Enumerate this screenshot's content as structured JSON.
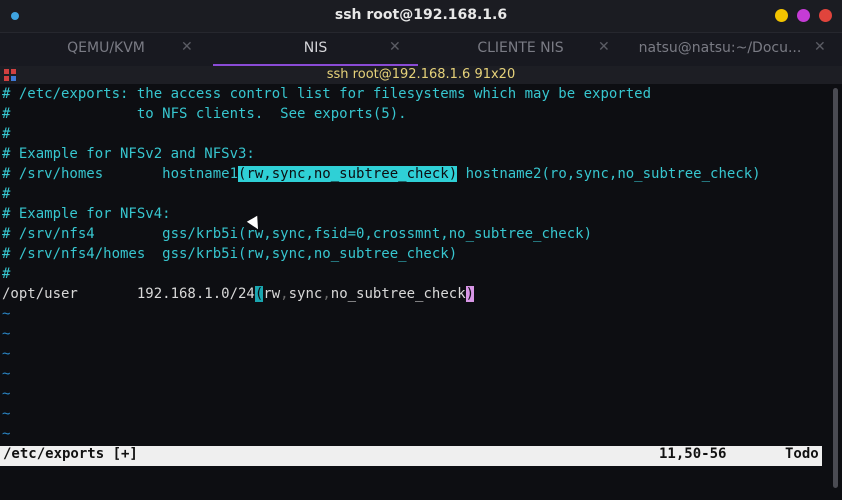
{
  "window": {
    "title": "ssh root@192.168.1.6",
    "btn_colors": {
      "minimize": "#f2c300",
      "maximize": "#c53bd6",
      "close": "#e0443c"
    }
  },
  "tabs": [
    {
      "label": "QEMU/KVM",
      "active": false
    },
    {
      "label": "NIS",
      "active": true
    },
    {
      "label": "CLIENTE NIS",
      "active": false
    },
    {
      "label": "natsu@natsu:~/Docu...",
      "active": false
    }
  ],
  "session": {
    "title": "ssh root@192.168.1.6 91x20"
  },
  "editor": {
    "lines": [
      "# /etc/exports: the access control list for filesystems which may be exported",
      "#               to NFS clients.  See exports(5).",
      "#",
      "# Example for NFSv2 and NFSv3:",
      "# /srv/homes       hostname1",
      "(rw,sync,no_subtree_check)",
      " hostname2(ro,sync,no_subtree_check)",
      "#",
      "# Example for NFSv4:",
      "# /srv/nfs4        gss/krb5i(rw,sync,fsid=0,crossmnt,no_subtree_check)",
      "# /srv/nfs4/homes  gss/krb5i(rw,sync,no_subtree_check)",
      "#",
      "/opt/user       192.168.1.0/24",
      "(",
      "rw",
      ",",
      "sync",
      ",",
      "no_subtree_check",
      ")",
      "~"
    ],
    "status": {
      "file": "/etc/exports [+]",
      "position": "11,50-56",
      "scroll": "Todo"
    }
  }
}
